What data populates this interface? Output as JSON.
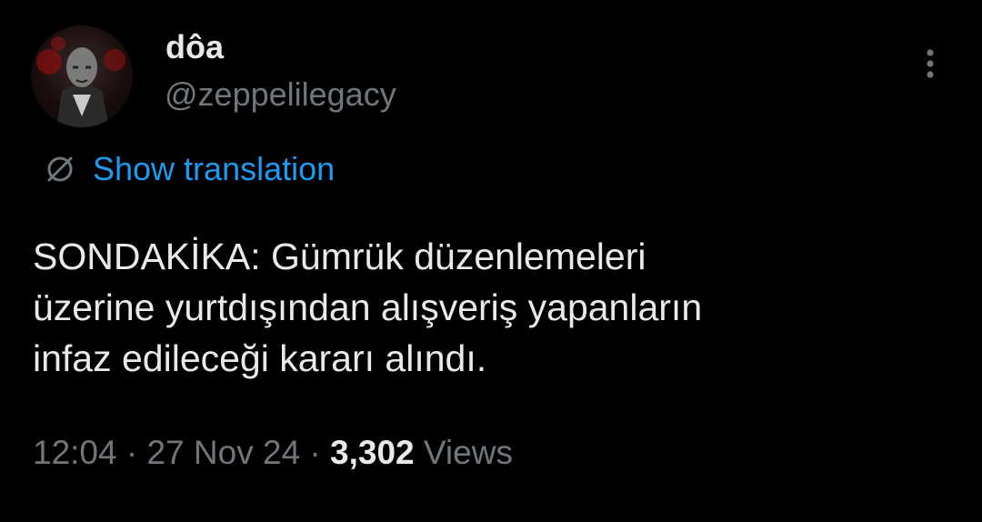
{
  "author": {
    "display_name": "dôa",
    "handle": "@zeppelilegacy"
  },
  "translation": {
    "label": "Show translation",
    "icon": "globe-icon"
  },
  "tweet": {
    "lines": [
      "SONDAKİKA: Gümrük düzenlemeleri",
      "üzerine yurtdışından alışveriş yapanların",
      "infaz edileceği kararı alındı."
    ]
  },
  "meta": {
    "time": "12:04",
    "separator": " · ",
    "date": "27 Nov 24",
    "views_count": "3,302",
    "views_label": "Views"
  },
  "icons": {
    "more": "more-vertical-icon",
    "avatar": "avatar"
  },
  "colors": {
    "background": "#000000",
    "primary_text": "#e7e9ea",
    "secondary_text": "#71767b",
    "link": "#1d9bf0"
  }
}
